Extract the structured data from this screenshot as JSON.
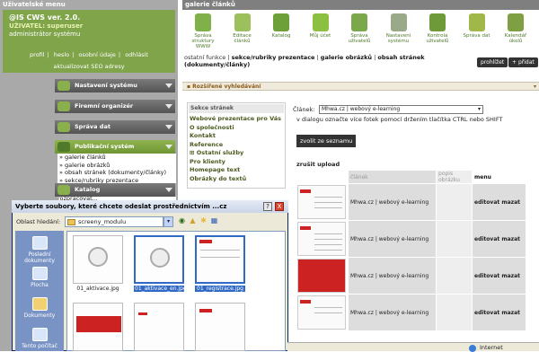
{
  "sidebar": {
    "header": "Uživatelské menu",
    "version": "@IS CWS ver. 2.0.",
    "user_label": "UŽIVATEL: superuser",
    "user_role": "administrátor systému",
    "links": [
      "profil",
      "heslo",
      "osobní údaje",
      "odhlásit"
    ],
    "seo_link": "aktualizovat SEO adresy",
    "menus": [
      {
        "label": "Nastavení systému",
        "active": false
      },
      {
        "label": "Firemní organizér",
        "active": false
      },
      {
        "label": "Správa dat",
        "active": false
      },
      {
        "label": "Publikační systém",
        "active": true
      },
      {
        "label": "Katalog",
        "active": false
      }
    ],
    "pub_items": [
      "galerie článků",
      "galerie obrázků",
      "obsah stránek (dokumenty/články)",
      "sekce/rubriky prezentace"
    ],
    "katalog_item": "rozpracovat..."
  },
  "main": {
    "header": "galerie článků",
    "toolbar": [
      {
        "label": "Správa struktury WWW",
        "color": "#7fb04a"
      },
      {
        "label": "Editace článků",
        "color": "#9cc05c"
      },
      {
        "label": "Katalog",
        "color": "#6ea03a"
      },
      {
        "label": "Můj účet",
        "color": "#8cc040"
      },
      {
        "label": "Správa uživatelů",
        "color": "#7aa84a"
      },
      {
        "label": "Nastavení systému",
        "color": "#9aaa88"
      },
      {
        "label": "Kontrola uživatelů",
        "color": "#6f9a3a"
      },
      {
        "label": "Správa dat",
        "color": "#a0b84a"
      },
      {
        "label": "Kalendář úkolů",
        "color": "#7fa042"
      }
    ],
    "path_prefix": "ostatní funkce |",
    "path_links": [
      "sekce/rubriky prezentace",
      "galerie obrázků",
      "obsah stránek (dokumenty/články)"
    ],
    "btn_prohlizet": "prohlížet",
    "btn_pridat": "přidat",
    "advanced_search": "Rozšířené vyhledávání",
    "sekce_header": "Sekce stránek",
    "sekce_items": [
      "Webové prezentace pro Vás",
      "O společnosti",
      "Kontakt",
      "Reference",
      "Ostatní služby",
      "Pro klienty",
      "Homepage text",
      "Obrázky do textů"
    ],
    "clanek_label": "Článek:",
    "clanek_value": "Mhwa.cz | webový e-learning",
    "hint": "v dialogu označte více fotek pomocí držením tlačítka CTRL nebo SHIFT",
    "choose_btn": "zvolit ze seznamu",
    "cancel_upload": "zrušit upload",
    "table": {
      "headers": [
        "článek",
        "popis obrázku",
        "menu"
      ],
      "rows": [
        {
          "name": "Mhwa.cz | webový e-learning",
          "desc": "",
          "actions": "editovat mazat"
        },
        {
          "name": "Mhwa.cz | webový e-learning",
          "desc": "",
          "actions": "editovat mazat"
        },
        {
          "name": "Mhwa.cz | webový e-learning",
          "desc": "",
          "actions": "editovat mazat"
        },
        {
          "name": "Mhwa.cz | webový e-learning",
          "desc": "",
          "actions": "editovat mazat"
        }
      ]
    }
  },
  "dialog": {
    "title": "Vyberte soubory, které chcete odeslat prostřednictvím ...cz",
    "help_btn": "?",
    "close_btn": "X",
    "location_label": "Oblast hledání:",
    "location_value": "screeny_modulu",
    "places": [
      "Poslední dokumenty",
      "Plocha",
      "Dokumenty",
      "Tento počítač"
    ],
    "files": [
      {
        "name": "01_aktivace.jpg",
        "selected": false
      },
      {
        "name": "01_aktivace_en.jpg",
        "selected": true
      },
      {
        "name": "01_registrace.jpg",
        "selected": true
      },
      {
        "name": "",
        "selected": false
      },
      {
        "name": "",
        "selected": false
      },
      {
        "name": "",
        "selected": false
      }
    ]
  },
  "statusbar": {
    "zone": "Internet"
  },
  "colors": {
    "accent_green": "#7fa44a",
    "sidebar_gray": "#a9a9a9",
    "dialog_bg": "#ece9d8"
  }
}
